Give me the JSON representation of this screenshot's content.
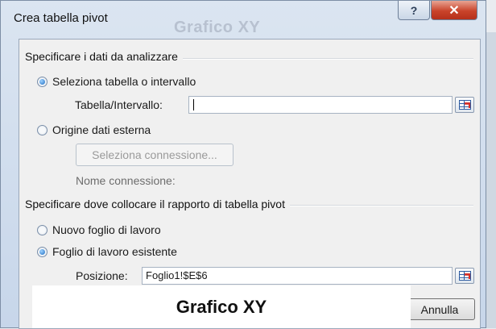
{
  "window": {
    "title": "Crea tabella pivot",
    "ghost_title": "Grafico XY",
    "help_label": "?",
    "close_label": "✕"
  },
  "data_section": {
    "heading": "Specificare i dati da analizzare",
    "option_table": "Seleziona tabella o intervallo",
    "table_field_label": "Tabella/Intervallo:",
    "table_field_value": "",
    "option_external": "Origine dati esterna",
    "choose_connection_button": "Seleziona connessione...",
    "connection_name_label": "Nome connessione:"
  },
  "location_section": {
    "heading": "Specificare dove collocare il rapporto di tabella pivot",
    "option_new_sheet": "Nuovo foglio di lavoro",
    "option_existing_sheet": "Foglio di lavoro esistente",
    "position_label": "Posizione:",
    "position_value": "Foglio1!$E$6"
  },
  "buttons": {
    "cancel": "Annulla"
  },
  "overlay": {
    "caption": "Grafico XY"
  },
  "state": {
    "data_source_selected": "table",
    "location_selected": "existing"
  },
  "icons": {
    "range_picker": "range-selector-icon",
    "help": "help-icon",
    "close": "close-icon"
  },
  "colors": {
    "close_button": "#c9432a",
    "radio_selected": "#1d6cc2",
    "title_bar": "#dbe5f1"
  }
}
